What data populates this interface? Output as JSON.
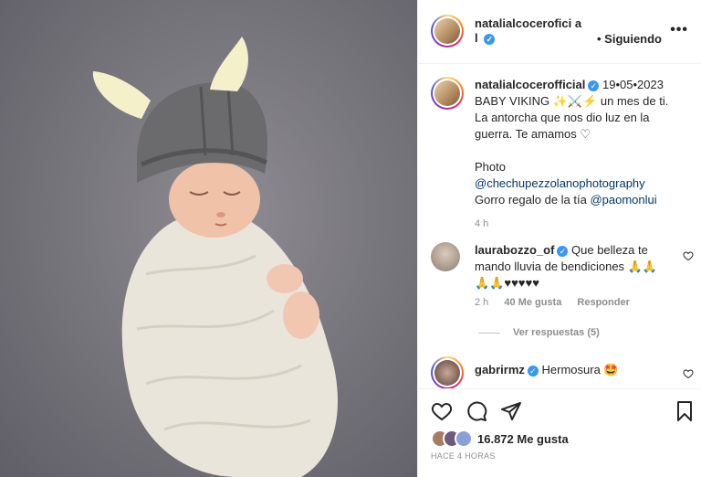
{
  "post": {
    "photo_alt": "",
    "username": "natalialcocerofici al",
    "follow_status": "• Siguiendo",
    "more_icon": "more-options-icon"
  },
  "caption": {
    "username": "natalialcocerofficial",
    "date": "19•05•2023",
    "line1": "BABY VIKING ✨⚔️⚡ un mes de ti.",
    "line2": "La antorcha que nos dio luz en la",
    "line3": "guerra. Te amamos ♡",
    "photo_label": "Photo",
    "photo_credit": "@chechupezzolanophotography",
    "gift_text": "Gorro regalo de la tía ",
    "gift_mention": "@paomonlui",
    "time": "4 h"
  },
  "comments": [
    {
      "username": "laurabozzo_of",
      "text1": " Que belleza te",
      "text2": "mando lluvia de bendiciones 🙏🙏",
      "text3": "🙏🙏♥♥♥♥♥",
      "time": "2 h",
      "likes": "40 Me gusta",
      "reply": "Responder"
    },
    {
      "username": "gabrirmz",
      "text1": " Hermosura 🤩"
    }
  ],
  "replies": {
    "label": "Ver respuestas (5)"
  },
  "footer": {
    "likes": "16.872 Me gusta",
    "time_ago": "HACE 4 HORAS"
  },
  "colors": {
    "verified": "#3897f0",
    "link": "#00376b",
    "muted": "#8e8e8e"
  }
}
